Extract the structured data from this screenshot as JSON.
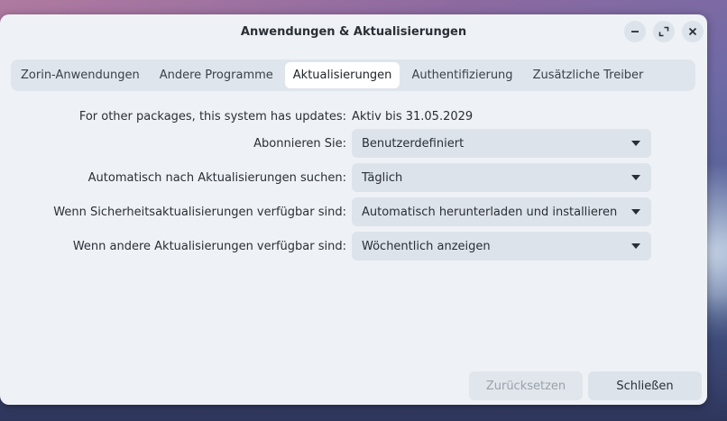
{
  "window": {
    "title": "Anwendungen & Aktualisierungen"
  },
  "tabs": [
    {
      "label": "Zorin-Anwendungen",
      "active": false
    },
    {
      "label": "Andere Programme",
      "active": false
    },
    {
      "label": "Aktualisierungen",
      "active": true
    },
    {
      "label": "Authentifizierung",
      "active": false
    },
    {
      "label": "Zusätzliche Treiber",
      "active": false
    }
  ],
  "form": {
    "status_label": "For other packages, this system has updates:",
    "status_value": "Aktiv bis 31.05.2029",
    "subscribe_label": "Abonnieren Sie:",
    "subscribe_value": "Benutzerdefiniert",
    "check_label": "Automatisch nach Aktualisierungen suchen:",
    "check_value": "Täglich",
    "security_label": "Wenn Sicherheitsaktualisierungen verfügbar sind:",
    "security_value": "Automatisch herunterladen und installieren",
    "other_label": "Wenn andere Aktualisierungen verfügbar sind:",
    "other_value": "Wöchentlich anzeigen"
  },
  "buttons": {
    "reset": "Zurücksetzen",
    "close": "Schließen"
  },
  "icons": {
    "minimize": "minimize-icon",
    "maximize": "maximize-icon",
    "close": "close-icon",
    "dropdown": "chevron-down-icon"
  }
}
